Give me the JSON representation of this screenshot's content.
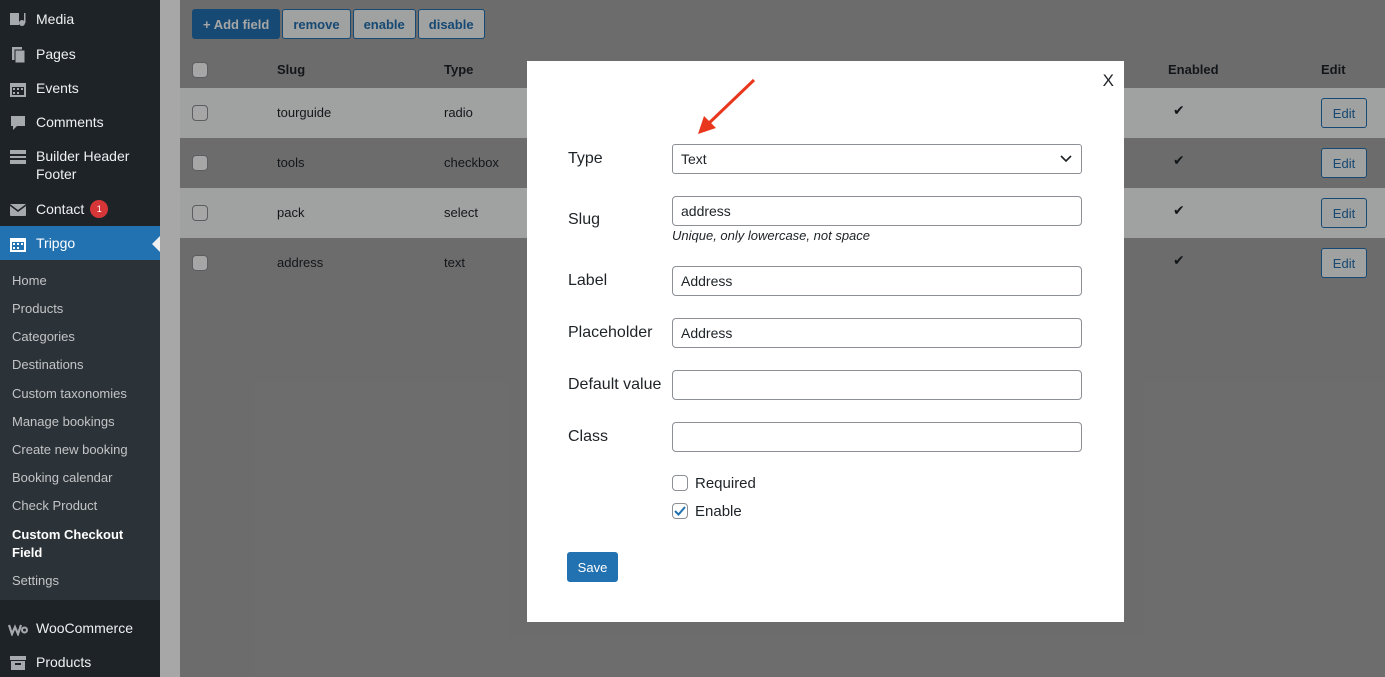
{
  "sidebar": {
    "items": [
      {
        "label": "Media",
        "icon": "media-icon"
      },
      {
        "label": "Pages",
        "icon": "pages-icon"
      },
      {
        "label": "Events",
        "icon": "calendar-icon"
      },
      {
        "label": "Comments",
        "icon": "comments-icon"
      },
      {
        "label": "Builder Header Footer",
        "icon": "builder-icon"
      },
      {
        "label": "Contact",
        "icon": "mail-icon",
        "badge": "1"
      },
      {
        "label": "Tripgo",
        "icon": "calendar-icon",
        "active": true
      },
      {
        "label": "WooCommerce",
        "icon": "woocommerce-icon"
      },
      {
        "label": "Products",
        "icon": "archive-icon"
      }
    ],
    "submenu": [
      "Home",
      "Products",
      "Categories",
      "Destinations",
      "Custom taxonomies",
      "Manage bookings",
      "Create new booking",
      "Booking calendar",
      "Check Product",
      "Custom Checkout Field",
      "Settings"
    ],
    "submenu_current": "Custom Checkout Field"
  },
  "toolbar": {
    "add_label": "+ Add field",
    "remove_label": "remove",
    "enable_label": "enable",
    "disable_label": "disable"
  },
  "table": {
    "headers": {
      "slug": "Slug",
      "type": "Type",
      "enabled": "Enabled",
      "edit": "Edit"
    },
    "rows": [
      {
        "slug": "tourguide",
        "type": "radio",
        "enabled": "✔",
        "edit": "Edit"
      },
      {
        "slug": "tools",
        "type": "checkbox",
        "enabled": "✔",
        "edit": "Edit"
      },
      {
        "slug": "pack",
        "type": "select",
        "enabled": "✔",
        "edit": "Edit"
      },
      {
        "slug": "address",
        "type": "text",
        "enabled": "✔",
        "edit": "Edit"
      }
    ]
  },
  "modal": {
    "close_label": "X",
    "type_label": "Type",
    "type_value": "Text",
    "slug_label": "Slug",
    "slug_value": "address",
    "slug_hint": "Unique, only lowercase, not space",
    "label_label": "Label",
    "label_value": "Address",
    "placeholder_label": "Placeholder",
    "placeholder_value": "Address",
    "default_label": "Default value",
    "default_value": "",
    "class_label": "Class",
    "class_value": "",
    "required_label": "Required",
    "required_checked": false,
    "enable_label": "Enable",
    "enable_checked": true,
    "save_label": "Save"
  },
  "colors": {
    "accent": "#2271b1",
    "sidebar_bg": "#1d2327",
    "arrow": "#e8371c"
  }
}
